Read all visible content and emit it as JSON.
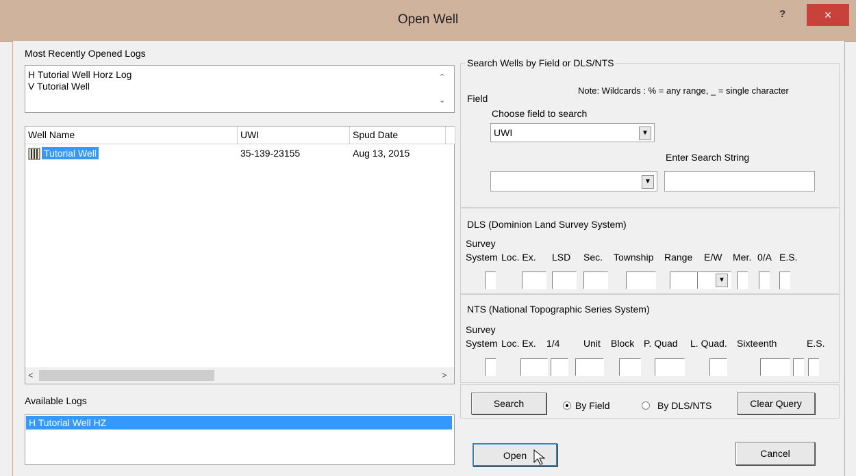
{
  "window": {
    "title": "Open Well",
    "help": "?",
    "close": "×"
  },
  "recent": {
    "label": "Most Recently Opened Logs",
    "items": [
      "H  Tutorial Well Horz Log",
      "V  Tutorial Well"
    ]
  },
  "wells": {
    "columns": [
      "Well Name",
      "UWI",
      "Spud Date"
    ],
    "rows": [
      {
        "name": "Tutorial Well",
        "uwi": "35-139-23155",
        "spud": "Aug 13, 2015"
      }
    ]
  },
  "available": {
    "label": "Available Logs",
    "items": [
      "H  Tutorial Well HZ"
    ]
  },
  "search": {
    "group_label": "Search Wells by Field or DLS/NTS",
    "note": "Note: Wildcards : % = any range, _ = single character",
    "field_label": "Field",
    "choose_label": "Choose field to search",
    "field_value": "UWI",
    "enter_label": "Enter Search String"
  },
  "dls": {
    "label": "DLS (Dominion Land Survey System)",
    "survey": "Survey",
    "cols": [
      "System",
      "Loc. Ex.",
      "LSD",
      "Sec.",
      "Township",
      "Range",
      "E/W",
      "Mer.",
      "0/A",
      "E.S."
    ]
  },
  "nts": {
    "label": "NTS (National Topographic Series System)",
    "survey": "Survey",
    "cols": [
      "System",
      "Loc. Ex.",
      "1/4",
      "Unit",
      "Block",
      "P. Quad",
      "L. Quad.",
      "Sixteenth",
      "E.S."
    ]
  },
  "buttons": {
    "search": "Search",
    "clear": "Clear Query",
    "open": "Open",
    "cancel": "Cancel"
  },
  "radios": {
    "by_field": "By Field",
    "by_dls": "By DLS/NTS",
    "selected": "by_field"
  },
  "colors": {
    "titlebar": "#cfb39c",
    "close": "#c8413a",
    "selection": "#3399ff"
  }
}
